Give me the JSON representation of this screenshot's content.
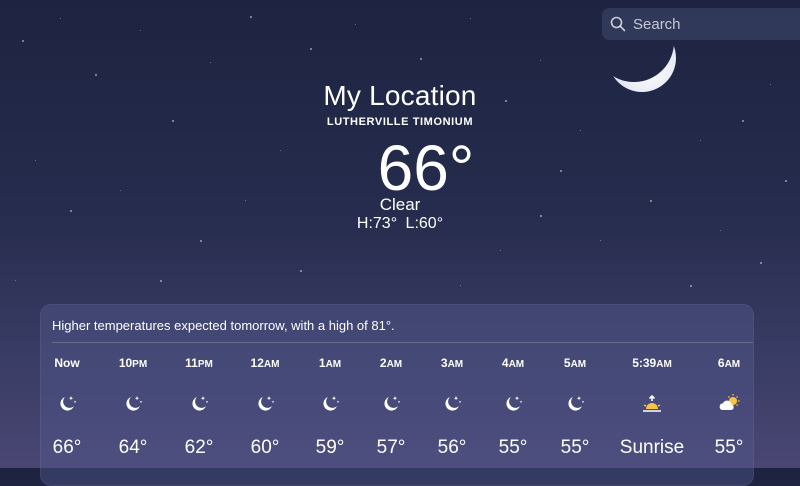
{
  "search": {
    "placeholder": "Search",
    "icon": "search-icon"
  },
  "location": {
    "title": "My Location",
    "subtitle": "LUTHERVILLE TIMONIUM",
    "temperature": "66°",
    "condition": "Clear",
    "high_low": "H:73°  L:60°"
  },
  "hourly": {
    "summary": "Higher temperatures expected tomorrow, with a high of 81°.",
    "hours": [
      {
        "time": "Now",
        "suffix": "",
        "icon": "moon-stars-icon",
        "temp": "66°"
      },
      {
        "time": "10",
        "suffix": "PM",
        "icon": "moon-stars-icon",
        "temp": "64°"
      },
      {
        "time": "11",
        "suffix": "PM",
        "icon": "moon-stars-icon",
        "temp": "62°"
      },
      {
        "time": "12",
        "suffix": "AM",
        "icon": "moon-stars-icon",
        "temp": "60°"
      },
      {
        "time": "1",
        "suffix": "AM",
        "icon": "moon-stars-icon",
        "temp": "59°"
      },
      {
        "time": "2",
        "suffix": "AM",
        "icon": "moon-stars-icon",
        "temp": "57°"
      },
      {
        "time": "3",
        "suffix": "AM",
        "icon": "moon-stars-icon",
        "temp": "56°"
      },
      {
        "time": "4",
        "suffix": "AM",
        "icon": "moon-stars-icon",
        "temp": "55°"
      },
      {
        "time": "5",
        "suffix": "AM",
        "icon": "moon-stars-icon",
        "temp": "55°"
      },
      {
        "time": "5:39",
        "suffix": "AM",
        "icon": "sunrise-icon",
        "temp": "Sunrise"
      },
      {
        "time": "6",
        "suffix": "AM",
        "icon": "partly-cloudy-sun-icon",
        "temp": "55°"
      }
    ]
  },
  "colors": {
    "sun": "#f5c542",
    "background_top": "#1d2340",
    "background_bottom": "#4a4673"
  }
}
